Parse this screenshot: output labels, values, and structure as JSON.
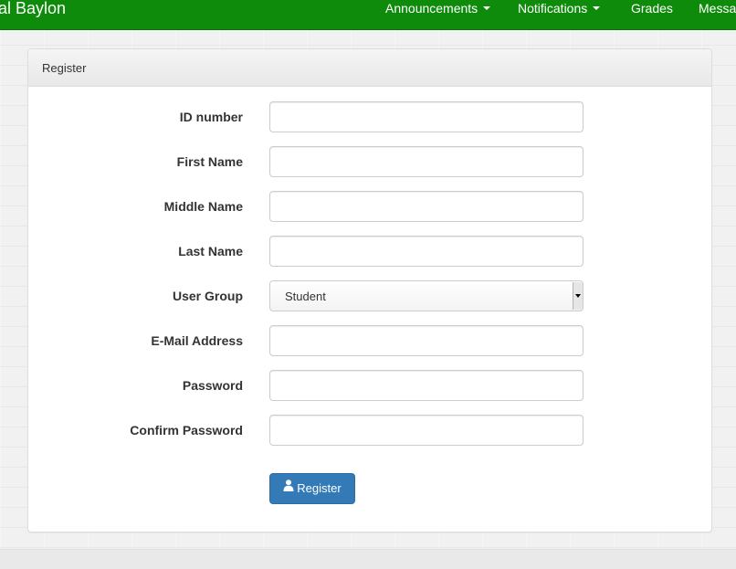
{
  "navbar": {
    "brand": "al Baylon",
    "items": [
      {
        "label": "Announcements",
        "dropdown": true
      },
      {
        "label": "Notifications",
        "dropdown": true
      },
      {
        "label": "Grades",
        "dropdown": false
      },
      {
        "label": "Messa",
        "dropdown": false
      }
    ]
  },
  "panel": {
    "title": "Register"
  },
  "form": {
    "id_number": {
      "label": "ID number",
      "value": ""
    },
    "first_name": {
      "label": "First Name",
      "value": ""
    },
    "middle_name": {
      "label": "Middle Name",
      "value": ""
    },
    "last_name": {
      "label": "Last Name",
      "value": ""
    },
    "user_group": {
      "label": "User Group",
      "selected": "Student"
    },
    "email": {
      "label": "E-Mail Address",
      "value": ""
    },
    "password": {
      "label": "Password",
      "value": ""
    },
    "confirm_password": {
      "label": "Confirm Password",
      "value": ""
    },
    "submit_label": "Register"
  },
  "icons": {
    "submit_icon": "user-icon",
    "dropdown_icon": "caret-down-icon"
  },
  "colors": {
    "navbar": "#0f8b0b",
    "primary_button": "#337ab7"
  }
}
